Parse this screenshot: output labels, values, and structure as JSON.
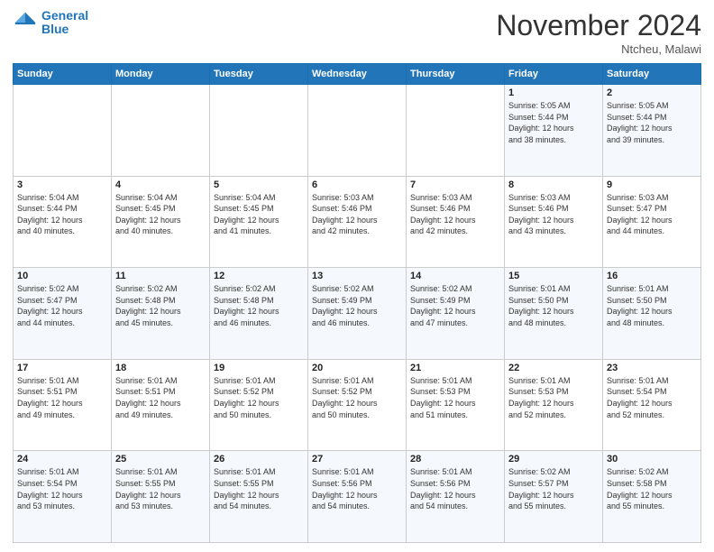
{
  "header": {
    "logo_line1": "General",
    "logo_line2": "Blue",
    "month_title": "November 2024",
    "location": "Ntcheu, Malawi"
  },
  "days_of_week": [
    "Sunday",
    "Monday",
    "Tuesday",
    "Wednesday",
    "Thursday",
    "Friday",
    "Saturday"
  ],
  "weeks": [
    [
      {
        "day": "",
        "info": ""
      },
      {
        "day": "",
        "info": ""
      },
      {
        "day": "",
        "info": ""
      },
      {
        "day": "",
        "info": ""
      },
      {
        "day": "",
        "info": ""
      },
      {
        "day": "1",
        "info": "Sunrise: 5:05 AM\nSunset: 5:44 PM\nDaylight: 12 hours\nand 38 minutes."
      },
      {
        "day": "2",
        "info": "Sunrise: 5:05 AM\nSunset: 5:44 PM\nDaylight: 12 hours\nand 39 minutes."
      }
    ],
    [
      {
        "day": "3",
        "info": "Sunrise: 5:04 AM\nSunset: 5:44 PM\nDaylight: 12 hours\nand 40 minutes."
      },
      {
        "day": "4",
        "info": "Sunrise: 5:04 AM\nSunset: 5:45 PM\nDaylight: 12 hours\nand 40 minutes."
      },
      {
        "day": "5",
        "info": "Sunrise: 5:04 AM\nSunset: 5:45 PM\nDaylight: 12 hours\nand 41 minutes."
      },
      {
        "day": "6",
        "info": "Sunrise: 5:03 AM\nSunset: 5:46 PM\nDaylight: 12 hours\nand 42 minutes."
      },
      {
        "day": "7",
        "info": "Sunrise: 5:03 AM\nSunset: 5:46 PM\nDaylight: 12 hours\nand 42 minutes."
      },
      {
        "day": "8",
        "info": "Sunrise: 5:03 AM\nSunset: 5:46 PM\nDaylight: 12 hours\nand 43 minutes."
      },
      {
        "day": "9",
        "info": "Sunrise: 5:03 AM\nSunset: 5:47 PM\nDaylight: 12 hours\nand 44 minutes."
      }
    ],
    [
      {
        "day": "10",
        "info": "Sunrise: 5:02 AM\nSunset: 5:47 PM\nDaylight: 12 hours\nand 44 minutes."
      },
      {
        "day": "11",
        "info": "Sunrise: 5:02 AM\nSunset: 5:48 PM\nDaylight: 12 hours\nand 45 minutes."
      },
      {
        "day": "12",
        "info": "Sunrise: 5:02 AM\nSunset: 5:48 PM\nDaylight: 12 hours\nand 46 minutes."
      },
      {
        "day": "13",
        "info": "Sunrise: 5:02 AM\nSunset: 5:49 PM\nDaylight: 12 hours\nand 46 minutes."
      },
      {
        "day": "14",
        "info": "Sunrise: 5:02 AM\nSunset: 5:49 PM\nDaylight: 12 hours\nand 47 minutes."
      },
      {
        "day": "15",
        "info": "Sunrise: 5:01 AM\nSunset: 5:50 PM\nDaylight: 12 hours\nand 48 minutes."
      },
      {
        "day": "16",
        "info": "Sunrise: 5:01 AM\nSunset: 5:50 PM\nDaylight: 12 hours\nand 48 minutes."
      }
    ],
    [
      {
        "day": "17",
        "info": "Sunrise: 5:01 AM\nSunset: 5:51 PM\nDaylight: 12 hours\nand 49 minutes."
      },
      {
        "day": "18",
        "info": "Sunrise: 5:01 AM\nSunset: 5:51 PM\nDaylight: 12 hours\nand 49 minutes."
      },
      {
        "day": "19",
        "info": "Sunrise: 5:01 AM\nSunset: 5:52 PM\nDaylight: 12 hours\nand 50 minutes."
      },
      {
        "day": "20",
        "info": "Sunrise: 5:01 AM\nSunset: 5:52 PM\nDaylight: 12 hours\nand 50 minutes."
      },
      {
        "day": "21",
        "info": "Sunrise: 5:01 AM\nSunset: 5:53 PM\nDaylight: 12 hours\nand 51 minutes."
      },
      {
        "day": "22",
        "info": "Sunrise: 5:01 AM\nSunset: 5:53 PM\nDaylight: 12 hours\nand 52 minutes."
      },
      {
        "day": "23",
        "info": "Sunrise: 5:01 AM\nSunset: 5:54 PM\nDaylight: 12 hours\nand 52 minutes."
      }
    ],
    [
      {
        "day": "24",
        "info": "Sunrise: 5:01 AM\nSunset: 5:54 PM\nDaylight: 12 hours\nand 53 minutes."
      },
      {
        "day": "25",
        "info": "Sunrise: 5:01 AM\nSunset: 5:55 PM\nDaylight: 12 hours\nand 53 minutes."
      },
      {
        "day": "26",
        "info": "Sunrise: 5:01 AM\nSunset: 5:55 PM\nDaylight: 12 hours\nand 54 minutes."
      },
      {
        "day": "27",
        "info": "Sunrise: 5:01 AM\nSunset: 5:56 PM\nDaylight: 12 hours\nand 54 minutes."
      },
      {
        "day": "28",
        "info": "Sunrise: 5:01 AM\nSunset: 5:56 PM\nDaylight: 12 hours\nand 54 minutes."
      },
      {
        "day": "29",
        "info": "Sunrise: 5:02 AM\nSunset: 5:57 PM\nDaylight: 12 hours\nand 55 minutes."
      },
      {
        "day": "30",
        "info": "Sunrise: 5:02 AM\nSunset: 5:58 PM\nDaylight: 12 hours\nand 55 minutes."
      }
    ]
  ]
}
